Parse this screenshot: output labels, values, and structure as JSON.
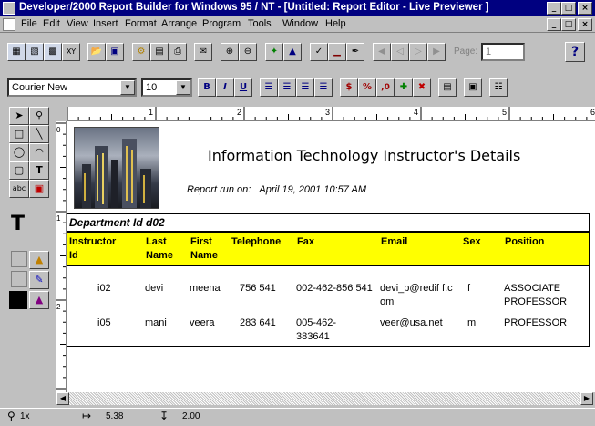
{
  "window": {
    "title": "Developer/2000 Report Builder for Windows 95 / NT - [Untitled: Report Editor - Live Previewer ]",
    "controls": {
      "minimize": "_",
      "maximize": "□",
      "close": "×"
    }
  },
  "menubar": {
    "items": [
      "File",
      "Edit",
      "View",
      "Insert",
      "Format",
      "Arrange",
      "Program",
      "Tools",
      "Window",
      "Help"
    ]
  },
  "toolbar": {
    "page_label": "Page:",
    "page_value": "1",
    "help_label": "?"
  },
  "format_toolbar": {
    "font": "Courier New",
    "size": "10",
    "bold": "B",
    "italic": "I",
    "underline": "U",
    "currency": "$",
    "percent": "%",
    "comma": ",0"
  },
  "palette": {
    "text_tool": "T",
    "field_label": "abc"
  },
  "report": {
    "title": "Information Technology Instructor's Details",
    "run_label": "Report run on:",
    "run_date": "April 19, 2001 10:57 AM",
    "department": "Department Id d02",
    "columns": [
      "Instructor Id",
      "Last Name",
      "First Name",
      "Telephone",
      "Fax",
      "Email",
      "Sex",
      "Position"
    ],
    "rows": [
      {
        "instructor_id": "i02",
        "last_name": "devi",
        "first_name": "meena",
        "telephone": "756 541",
        "fax": "002-462-856 541",
        "email": "devi_b@redif f.com",
        "sex": "f",
        "position": "ASSOCIATE PROFESSOR"
      },
      {
        "instructor_id": "i05",
        "last_name": "mani",
        "first_name": "veera",
        "telephone": "283 641",
        "fax": "005-462-383641",
        "email": "veer@usa.net",
        "sex": "m",
        "position": "PROFESSOR"
      }
    ]
  },
  "ruler": {
    "h_labels": [
      "1",
      "2",
      "3",
      "4",
      "5",
      "6"
    ],
    "v_labels": [
      "0",
      "1",
      "2"
    ]
  },
  "statusbar": {
    "zoom": "1x",
    "x_pos": "5.38",
    "y_pos": "2.00"
  },
  "colors": {
    "titlebar": "#000080",
    "header_band": "#ffff00",
    "chrome": "#c0c0c0"
  }
}
